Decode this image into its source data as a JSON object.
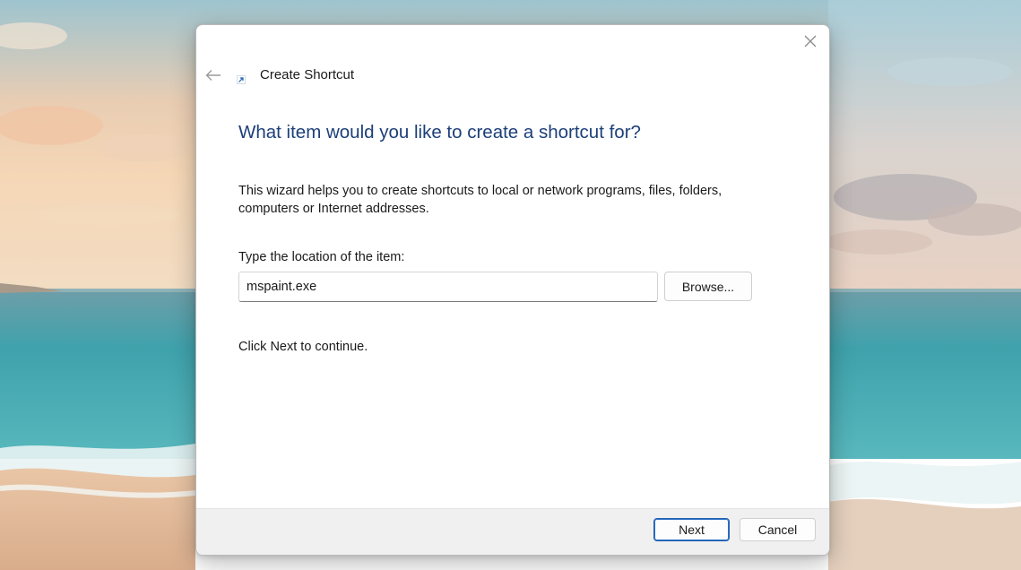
{
  "window": {
    "title": "Create Shortcut",
    "close_icon": "close-icon",
    "back_icon": "back-arrow-icon",
    "app_icon": "shortcut-arrow-icon"
  },
  "content": {
    "heading": "What item would you like to create a shortcut for?",
    "description": "This wizard helps you to create shortcuts to local or network programs, files, folders, computers or Internet addresses.",
    "location_label": "Type the location of the item:",
    "location_value": "mspaint.exe",
    "browse_label": "Browse...",
    "continue_text": "Click Next to continue."
  },
  "footer": {
    "next_label": "Next",
    "cancel_label": "Cancel"
  },
  "colors": {
    "heading": "#1c3f7a",
    "default_button_border": "#1f5fb0",
    "footer_bg": "#f0f0f0"
  }
}
